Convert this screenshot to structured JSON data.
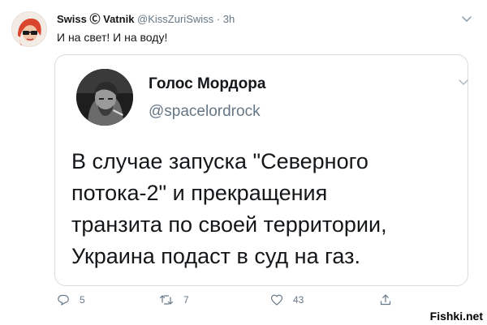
{
  "outer_tweet": {
    "author_name": "Swiss",
    "author_symbol": "Ⓒ",
    "author_name_suffix": "Vatnik",
    "handle": "@KissZuriSwiss",
    "separator": "·",
    "time": "3h",
    "text": "И на свет! И на воду!",
    "menu_icon": "chevron-down-icon"
  },
  "quoted_tweet": {
    "author_name": "Голос Мордора",
    "handle": "@spacelordrock",
    "menu_icon": "chevron-down-icon",
    "text_lines": [
      "В случае запуска \"Северного",
      "потока-2\" и прекращения",
      "транзита по своей территории,",
      "Украина подаст в суд на газ."
    ]
  },
  "actions": {
    "reply": {
      "icon": "reply-icon",
      "count": "5"
    },
    "retweet": {
      "icon": "retweet-icon",
      "count": "7"
    },
    "like": {
      "icon": "heart-icon",
      "count": "43"
    },
    "share": {
      "icon": "share-icon"
    }
  },
  "watermark": "Fishki.net",
  "colors": {
    "text": "#14171a",
    "muted": "#657786",
    "border": "#d6dde3",
    "background": "#ffffff"
  }
}
